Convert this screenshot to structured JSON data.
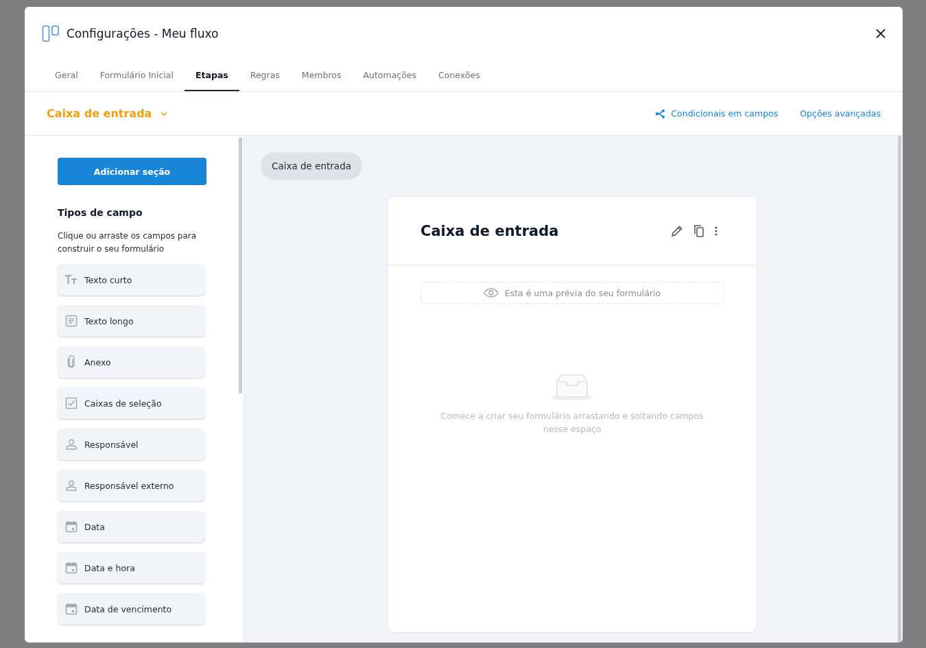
{
  "window": {
    "title": "Configurações - Meu fluxo"
  },
  "tabs": [
    {
      "label": "Geral",
      "selected": false
    },
    {
      "label": "Formulário Inicial",
      "selected": false
    },
    {
      "label": "Etapas",
      "selected": true
    },
    {
      "label": "Regras",
      "selected": false
    },
    {
      "label": "Membros",
      "selected": false
    },
    {
      "label": "Automações",
      "selected": false
    },
    {
      "label": "Conexões",
      "selected": false
    }
  ],
  "stage_bar": {
    "stage": "Caixa de entrada",
    "links": [
      "Condicionais em campos",
      "Opções avançadas"
    ]
  },
  "sidebar": {
    "button": "Adicionar seção",
    "heading": "Tipos de campo",
    "description": "Clique ou arraste os campos para construir o seu formulário",
    "fields": [
      {
        "kind": "short-text",
        "label": "Texto curto"
      },
      {
        "kind": "long-text",
        "label": "Texto longo"
      },
      {
        "kind": "attachment",
        "label": "Anexo"
      },
      {
        "kind": "checkbox",
        "label": "Caixas de seleção"
      },
      {
        "kind": "person",
        "label": "Responsável"
      },
      {
        "kind": "person",
        "label": "Responsável externo"
      },
      {
        "kind": "date",
        "label": "Data"
      },
      {
        "kind": "date",
        "label": "Data e hora"
      },
      {
        "kind": "date",
        "label": "Data de vencimento"
      }
    ]
  },
  "preview": {
    "chip": "Caixa de entrada",
    "card_title": "Caixa de entrada",
    "notice": "Esta é uma prévia do seu formulário",
    "empty_text": "Comece a criar seu formulário arrastando e soltando campos nesse espaço"
  }
}
